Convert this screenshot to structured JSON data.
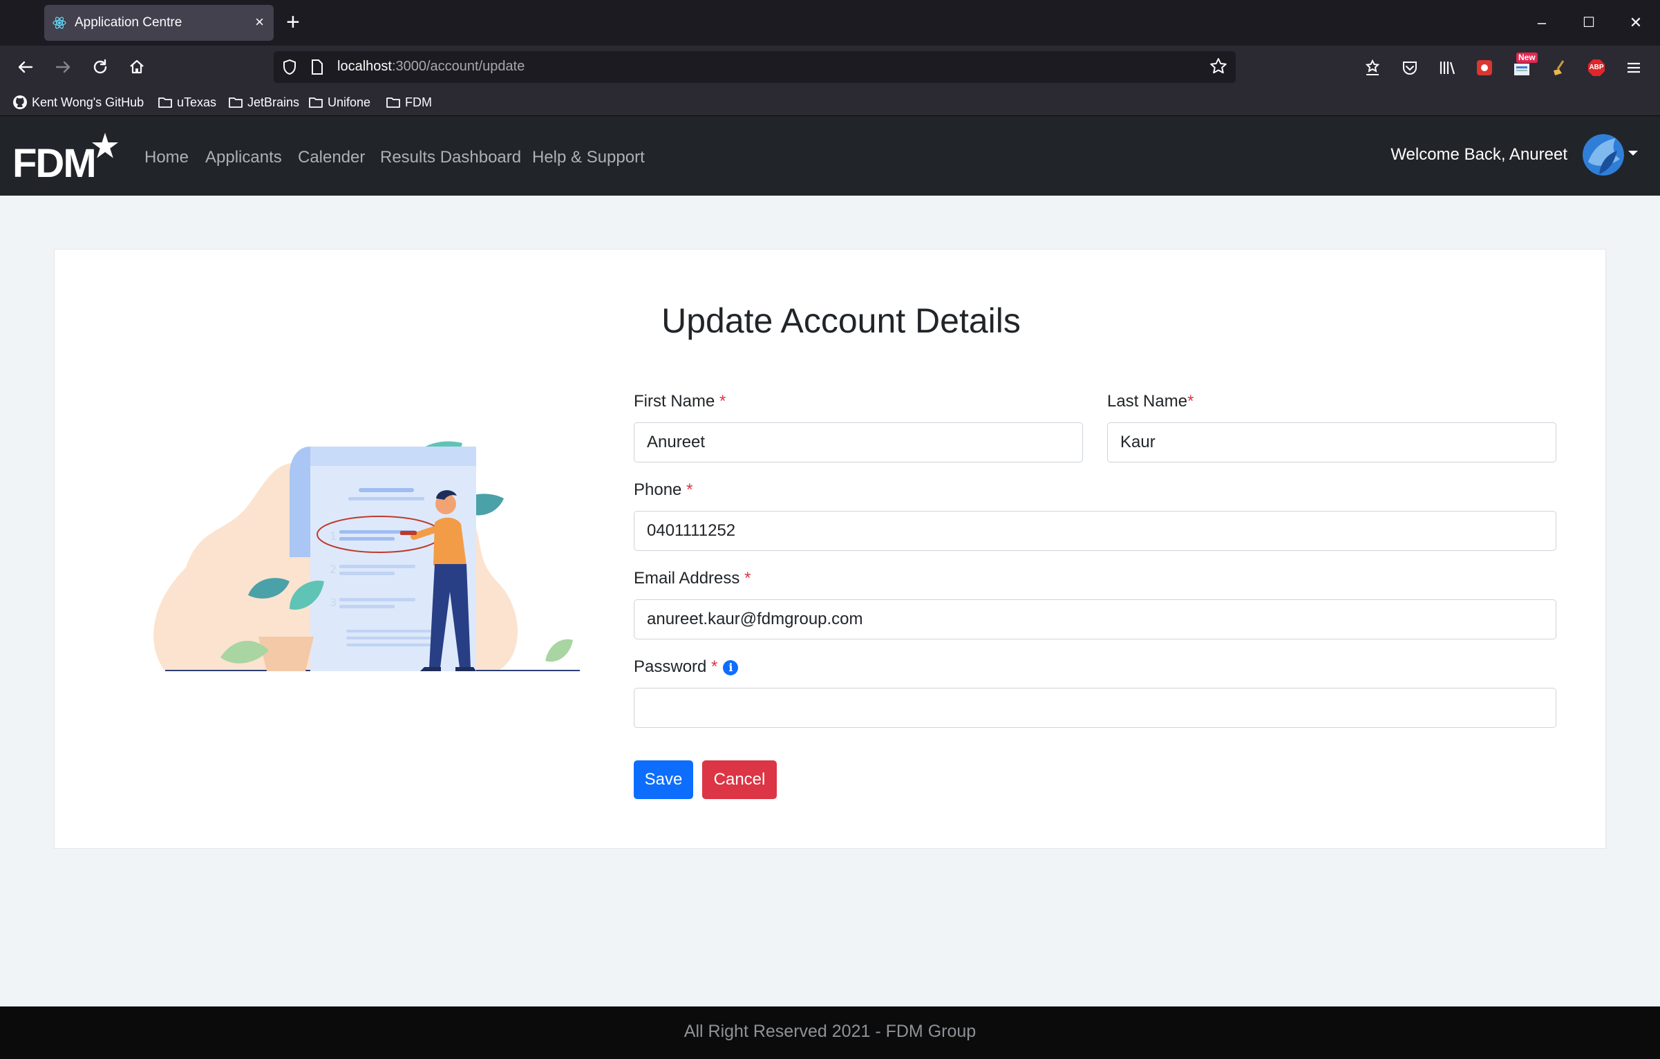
{
  "browser": {
    "tab_title": "Application Centre",
    "tab_close": "×",
    "new_tab": "+",
    "url_host": "localhost",
    "url_path": ":3000/account/update",
    "window_controls": {
      "minimize": "–",
      "maximize": "☐",
      "close": "✕"
    },
    "bookmarks": [
      {
        "label": "Kent Wong's GitHub",
        "icon": "github-icon"
      },
      {
        "label": "uTexas",
        "icon": "folder-icon"
      },
      {
        "label": "JetBrains",
        "icon": "folder-icon"
      },
      {
        "label": "Unifone",
        "icon": "folder-icon"
      },
      {
        "label": "FDM",
        "icon": "folder-icon"
      }
    ],
    "extension_badge": "New",
    "abp_label": "ABP"
  },
  "header": {
    "logo_text": "FDM",
    "nav": [
      "Home",
      "Applicants",
      "Calender",
      "Results Dashboard",
      "Help & Support"
    ],
    "welcome": "Welcome Back, Anureet"
  },
  "form": {
    "title": "Update Account Details",
    "required_mark": "*",
    "info_icon": "i",
    "first_name": {
      "label": "First Name",
      "value": "Anureet"
    },
    "last_name": {
      "label": "Last Name",
      "value": "Kaur"
    },
    "phone": {
      "label": "Phone",
      "value": "0401111252"
    },
    "email": {
      "label": "Email Address",
      "value": "anureet.kaur@fdmgroup.com"
    },
    "password": {
      "label": "Password",
      "value": ""
    },
    "save_label": "Save",
    "cancel_label": "Cancel"
  },
  "footer": {
    "text": "All Right Reserved 2021 - FDM Group"
  },
  "colors": {
    "primary": "#0d6efd",
    "danger": "#dc3545",
    "header_bg": "#212529",
    "page_bg": "#f0f4f7"
  }
}
